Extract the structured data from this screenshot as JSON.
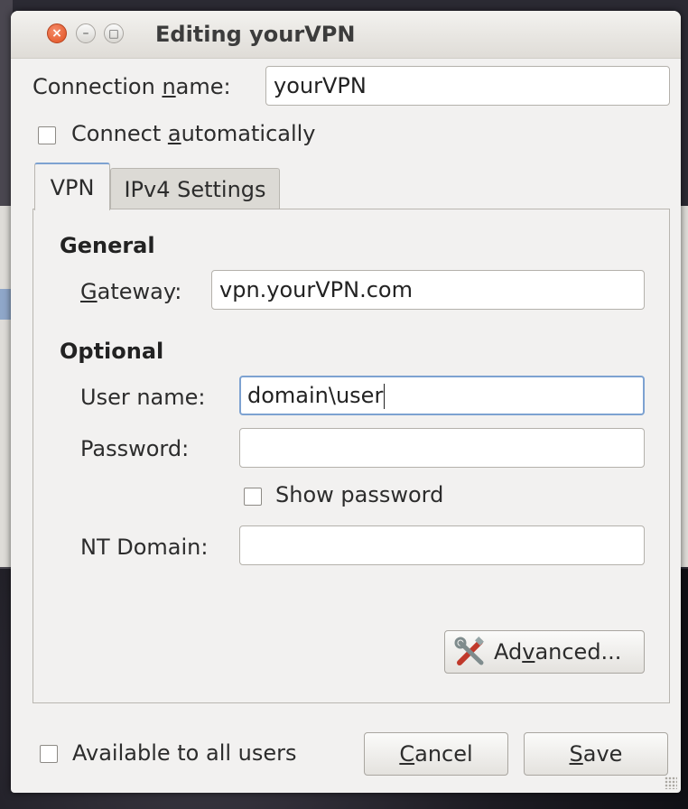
{
  "window": {
    "title": "Editing yourVPN",
    "close_glyph": "×",
    "minimize_glyph": "–",
    "maximize_glyph": "□"
  },
  "connection": {
    "name_label_before": "Connection ",
    "name_label_mnemonic": "n",
    "name_label_after": "ame:",
    "name_value": "yourVPN",
    "auto_label_before": "Connect ",
    "auto_label_mnemonic": "a",
    "auto_label_after": "utomatically",
    "auto_checked": false
  },
  "tabs": [
    {
      "label": "VPN",
      "active": true
    },
    {
      "label": "IPv4 Settings",
      "active": false
    }
  ],
  "general": {
    "heading": "General",
    "gateway_label_mnemonic": "G",
    "gateway_label_after": "ateway:",
    "gateway_value": "vpn.yourVPN.com"
  },
  "optional": {
    "heading": "Optional",
    "username_label": "User name:",
    "username_value": "domain\\user",
    "password_label": "Password:",
    "password_value": "",
    "show_password_label": "Show password",
    "show_password_checked": false,
    "ntdomain_label": "NT Domain:",
    "ntdomain_value": ""
  },
  "advanced": {
    "label_before": "Ad",
    "label_mnemonic": "v",
    "label_after": "anced...",
    "icon": "tools-icon"
  },
  "footer": {
    "all_users_label": "Available to all users",
    "all_users_checked": false,
    "cancel_mnemonic": "C",
    "cancel_after": "ancel",
    "save_mnemonic": "S",
    "save_after": "ave"
  },
  "colors": {
    "focus_border": "#7da2d1",
    "close_button": "#e1501f"
  }
}
